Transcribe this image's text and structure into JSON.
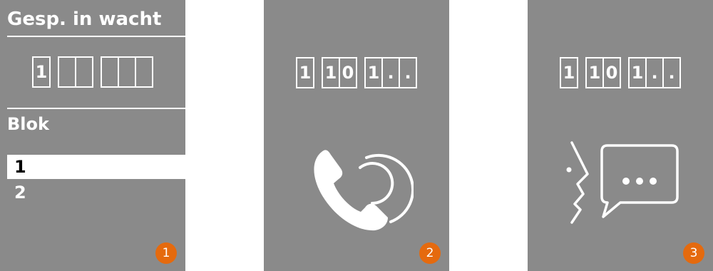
{
  "screen1": {
    "title": "Gesp. in wacht",
    "digit_groups": [
      [
        "1"
      ],
      [
        "",
        ""
      ],
      [
        "",
        "",
        ""
      ]
    ],
    "block_label": "Blok",
    "block_items": [
      {
        "label": "1",
        "selected": true
      },
      {
        "label": "2",
        "selected": false
      }
    ],
    "badge": "1"
  },
  "screen2": {
    "digit_groups": [
      [
        "1"
      ],
      [
        "1",
        "0"
      ],
      [
        "1",
        ".",
        "."
      ]
    ],
    "icon": "phone-ringing-icon",
    "badge": "2"
  },
  "screen3": {
    "digit_groups": [
      [
        "1"
      ],
      [
        "1",
        "0"
      ],
      [
        "1",
        ".",
        "."
      ]
    ],
    "icon": "speaking-conversation-icon",
    "badge": "3"
  },
  "colors": {
    "screen_bg": "#8a8a8a",
    "badge": "#e56a0e",
    "foreground": "#ffffff"
  }
}
